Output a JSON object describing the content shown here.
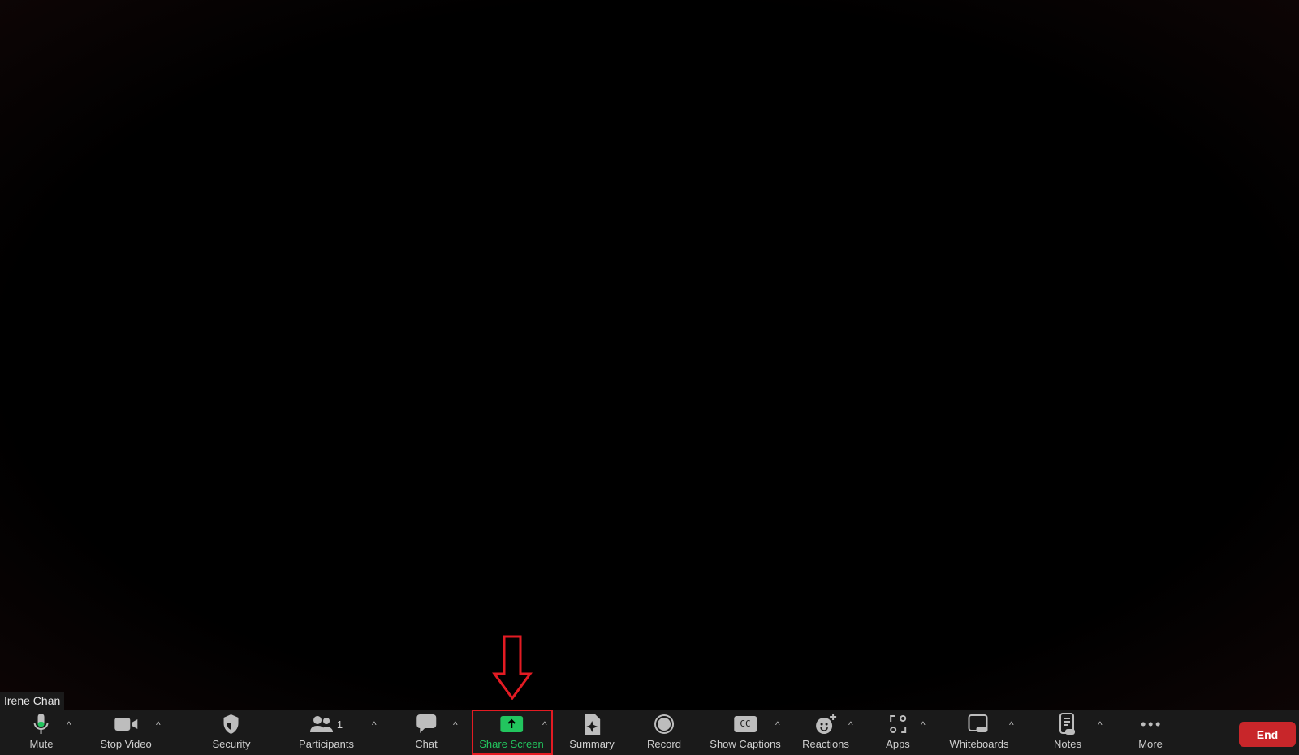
{
  "participant_name": "Irene Chan",
  "toolbar": {
    "mute": "Mute",
    "stop_video": "Stop Video",
    "security": "Security",
    "participants": "Participants",
    "participants_count": "1",
    "chat": "Chat",
    "share_screen": "Share Screen",
    "summary": "Summary",
    "record": "Record",
    "show_captions": "Show Captions",
    "captions_glyph": "CC",
    "reactions": "Reactions",
    "apps": "Apps",
    "whiteboards": "Whiteboards",
    "notes": "Notes",
    "more": "More",
    "end": "End",
    "caret": "^"
  },
  "colors": {
    "accent_green": "#22c55e",
    "end_red": "#c8262a",
    "highlight_red": "#e31b23",
    "toolbar_bg": "#1a1a1a"
  }
}
